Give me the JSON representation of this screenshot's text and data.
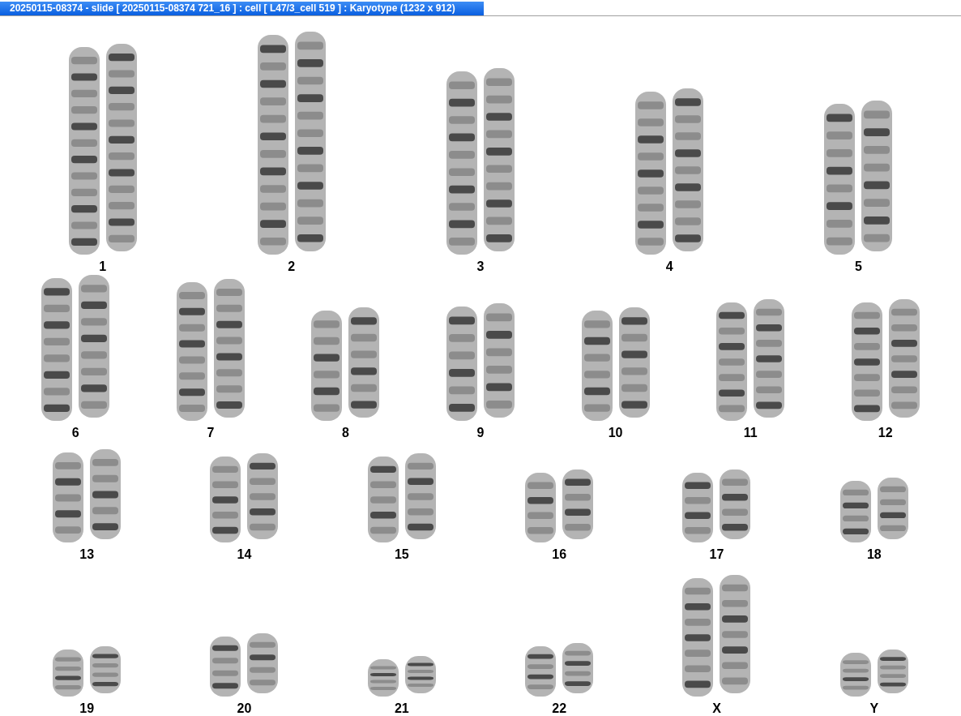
{
  "window": {
    "title": "20250115-08374 - slide [ 20250115-08374 721_16 ] : cell [ L47/3_cell 519 ] : Karyotype  (1232 x 912)"
  },
  "karyotype": {
    "rows": [
      {
        "chromosomes": [
          {
            "label": "1"
          },
          {
            "label": "2"
          },
          {
            "label": "3"
          },
          {
            "label": "4"
          },
          {
            "label": "5"
          }
        ]
      },
      {
        "chromosomes": [
          {
            "label": "6"
          },
          {
            "label": "7"
          },
          {
            "label": "8"
          },
          {
            "label": "9"
          },
          {
            "label": "10"
          },
          {
            "label": "11"
          },
          {
            "label": "12"
          }
        ]
      },
      {
        "chromosomes": [
          {
            "label": "13"
          },
          {
            "label": "14"
          },
          {
            "label": "15"
          },
          {
            "label": "16"
          },
          {
            "label": "17"
          },
          {
            "label": "18"
          }
        ]
      },
      {
        "chromosomes": [
          {
            "label": "19"
          },
          {
            "label": "20"
          },
          {
            "label": "21"
          },
          {
            "label": "22"
          },
          {
            "label": "X"
          },
          {
            "label": "Y"
          }
        ]
      }
    ]
  }
}
